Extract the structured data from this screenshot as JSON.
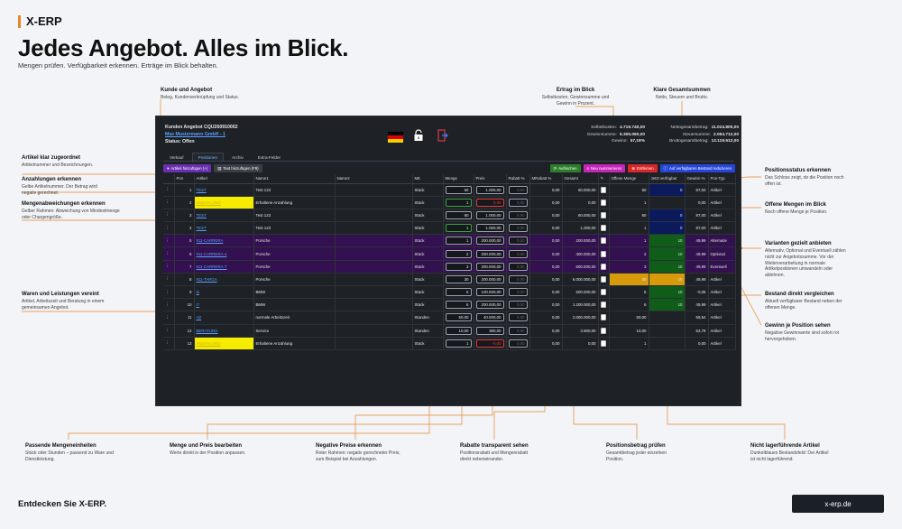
{
  "brand": "X-ERP",
  "hero": {
    "title": "Jedes Angebot. Alles im Blick.",
    "subtitle": "Mengen prüfen. Verfügbarkeit erkennen. Erträge im Blick behalten."
  },
  "annotations": {
    "kunde": {
      "title": "Kunde und Angebot",
      "text": "Beleg, Kundenverknüpfung und Status."
    },
    "ertrag": {
      "title": "Ertrag im Blick",
      "text": "Selbstkosten, Gewinnsumme und Gewinn in Prozent."
    },
    "gesamt": {
      "title": "Klare Gesamtsummen",
      "text": "Netto, Steuern und Brutto."
    },
    "artikel": {
      "title": "Artikel klar zugeordnet",
      "text": "Artikelnummer und Bezeichnungen."
    },
    "anzahlungen": {
      "title": "Anzahlungen erkennen",
      "text": "Gelbe Artikelnummer. Der Betrag wird negativ gerechnet."
    },
    "mengenabw": {
      "title": "Mengenabweichungen erkennen",
      "text": "Gelber Rahmen: Abweichung von Mindestmenge oder Chargengröße."
    },
    "waren": {
      "title": "Waren und Leistungen vereint",
      "text": "Artikel, Arbeitszeit und Beratung in einem gemeinsamen Angebot."
    },
    "positionsstatus": {
      "title": "Positionsstatus erkennen",
      "text": "Das Schloss zeigt, ob die Position noch offen ist."
    },
    "offene": {
      "title": "Offene Mengen im Blick",
      "text": "Noch offene Menge je Position."
    },
    "varianten": {
      "title": "Varianten gezielt anbieten",
      "text": "Alternativ, Optional und Eventuell zählen nicht zur Angebotssumme. Vor der Weiterverarbeitung in normale Artikelpositionen umwandeln oder ablehnen."
    },
    "bestand": {
      "title": "Bestand direkt vergleichen",
      "text": "Aktuell verfügbarer Bestand neben der offenen Menge."
    },
    "gewinn": {
      "title": "Gewinn je Position sehen",
      "text": "Negative Gewinnwerte sind sofort rot hervorgehoben."
    },
    "einheiten": {
      "title": "Passende Mengeneinheiten",
      "text": "Stück oder Stunden – passend zu Ware und Dienstleistung."
    },
    "mengepreis": {
      "title": "Menge und Preis bearbeiten",
      "text": "Werte direkt in der Position anpassen."
    },
    "negpreis": {
      "title": "Negative Preise erkennen",
      "text": "Roter Rahmen: negativ gerechneter Preis, zum Beispiel bei Anzahlungen."
    },
    "rabatte": {
      "title": "Rabatte transparent sehen",
      "text": "Positionsrabatt und Mengenrabatt direkt nebeneinander."
    },
    "posbetrag": {
      "title": "Positionsbetrag prüfen",
      "text": "Gesamtbetrag jeder einzelnen Position."
    },
    "nichtlager": {
      "title": "Nicht lagerführende Artikel",
      "text": "Dunkelblaues Bestandsfeld: Der Artikel ist nicht lagerführend."
    }
  },
  "app": {
    "doc_title": "Kunden Angebot CQU260910002",
    "customer": "Max Mustermann GmbH - 1",
    "status": "Status: Offen",
    "sums_left": [
      {
        "label": "Selbstkosten:",
        "value": "4.719.740,00"
      },
      {
        "label": "Gewinnsumme:",
        "value": "6.305.060,00"
      },
      {
        "label": "Gewinn:",
        "value": "57,19%"
      }
    ],
    "sums_right": [
      {
        "label": "Nettogesamtbetrag:",
        "value": "11.024.800,00"
      },
      {
        "label": "Steuersumme:",
        "value": "2.094.712,00"
      },
      {
        "label": "Bruttogesamtbetrag:",
        "value": "13.119.512,00"
      }
    ],
    "tabs": [
      "Verkauf",
      "Positionen",
      "Archiv",
      "Extra-Felder"
    ],
    "btn_add_article": "Artikel hinzufügen (+)",
    "btn_add_text": "Text hinzufügen (F9)",
    "btn_refresh": "Aufrischen",
    "btn_new": "Neu nummerieren",
    "btn_remove": "Entfernen",
    "btn_stock": "Auf verfügbaren Bestand reduzieren",
    "columns": [
      "",
      "Pos",
      "Artikel",
      "Name1",
      "Name2",
      "ME",
      "Menge",
      "Preis",
      "Rabatt %",
      "MRabatt %",
      "Gesamt",
      "",
      "Offene Menge",
      "Jetzt verfügbar",
      "Gewinn %",
      "Pos-Typ"
    ],
    "rows": [
      {
        "pos": "1",
        "artikel": "TEST",
        "name1": "Test 123",
        "me": "Stück",
        "menge": "60",
        "preis": "1.000,00",
        "rabatt": "0,00",
        "mrabatt": "0,00",
        "gesamt": "60.000,00",
        "offen": "60",
        "verf": "0",
        "gewinn": "87,00",
        "typ": "Artikel"
      },
      {
        "pos": "2",
        "artikel": "ANZAHLUNG",
        "name1": "Erhaltene Anzahlung",
        "me": "Stück",
        "menge": "1",
        "preis": "0,00",
        "rabatt": "0,00",
        "mrabatt": "0,00",
        "gesamt": "0,00",
        "offen": "1",
        "verf": "",
        "gewinn": "0,00",
        "typ": "Artikel"
      },
      {
        "pos": "3",
        "artikel": "TEST",
        "name1": "Test 123",
        "me": "Stück",
        "menge": "60",
        "preis": "1.000,00",
        "rabatt": "0,00",
        "mrabatt": "0,00",
        "gesamt": "60.000,00",
        "offen": "60",
        "verf": "0",
        "gewinn": "87,00",
        "typ": "Artikel"
      },
      {
        "pos": "4",
        "artikel": "TEST",
        "name1": "Test 123",
        "me": "Stück",
        "menge": "1",
        "preis": "1.000,00",
        "rabatt": "0,00",
        "mrabatt": "0,00",
        "gesamt": "1.000,00",
        "offen": "1",
        "verf": "0",
        "gewinn": "87,00",
        "typ": "Artikel"
      },
      {
        "pos": "5",
        "artikel": "911-CARRERA",
        "name1": "Porsche",
        "me": "Stück",
        "menge": "1",
        "preis": "200.000,00",
        "rabatt": "0,00",
        "mrabatt": "0,00",
        "gesamt": "200.000,00",
        "offen": "1",
        "verf": "10",
        "gewinn": "49,99",
        "typ": "Alternativ"
      },
      {
        "pos": "6",
        "artikel": "911-CARRERA-4",
        "name1": "Porsche",
        "me": "Stück",
        "menge": "2",
        "preis": "200.000,00",
        "rabatt": "0,00",
        "mrabatt": "0,00",
        "gesamt": "400.000,00",
        "offen": "2",
        "verf": "10",
        "gewinn": "49,99",
        "typ": "Optional"
      },
      {
        "pos": "7",
        "artikel": "911-CARRERA-T",
        "name1": "Porsche",
        "me": "Stück",
        "menge": "3",
        "preis": "200.000,00",
        "rabatt": "0,00",
        "mrabatt": "0,00",
        "gesamt": "600.000,00",
        "offen": "3",
        "verf": "10",
        "gewinn": "49,99",
        "typ": "Eventuell"
      },
      {
        "pos": "8",
        "artikel": "911-TARGA",
        "name1": "Porsche",
        "me": "Stück",
        "menge": "30",
        "preis": "200.000,00",
        "rabatt": "0,00",
        "mrabatt": "0,00",
        "gesamt": "6.000.000,00",
        "offen": "30",
        "verf": "10",
        "gewinn": "49,99",
        "typ": "Artikel"
      },
      {
        "pos": "9",
        "artikel": "i5",
        "name1": "BMW",
        "me": "Stück",
        "menge": "5",
        "preis": "100.000,00",
        "rabatt": "0,00",
        "mrabatt": "0,00",
        "gesamt": "500.000,00",
        "offen": "5",
        "verf": "10",
        "gewinn": "-0,05",
        "typ": "Artikel"
      },
      {
        "pos": "10",
        "artikel": "i7",
        "name1": "BMW",
        "me": "Stück",
        "menge": "6",
        "preis": "200.000,00",
        "rabatt": "0,00",
        "mrabatt": "0,00",
        "gesamt": "1.200.000,00",
        "offen": "6",
        "verf": "10",
        "gewinn": "49,99",
        "typ": "Artikel"
      },
      {
        "pos": "11",
        "artikel": "AZ",
        "name1": "normale Arbeitszeit",
        "me": "Stunden",
        "menge": "50,00",
        "preis": "40.000,00",
        "rabatt": "0,00",
        "mrabatt": "0,00",
        "gesamt": "2.000.000,00",
        "offen": "50,00",
        "verf": "",
        "gewinn": "59,54",
        "typ": "Artikel"
      },
      {
        "pos": "12",
        "artikel": "BERATUNG",
        "name1": "Service",
        "me": "Stunden",
        "menge": "10,00",
        "preis": "380,00",
        "rabatt": "0,00",
        "mrabatt": "0,00",
        "gesamt": "3.800,00",
        "offen": "10,00",
        "verf": "",
        "gewinn": "52,79",
        "typ": "Artikel"
      },
      {
        "pos": "13",
        "artikel": "ANZAHLUNG",
        "name1": "Erhaltene Anzahlung",
        "me": "Stück",
        "menge": "1",
        "preis": "-0,00",
        "rabatt": "0,00",
        "mrabatt": "0,00",
        "gesamt": "0,00",
        "offen": "1",
        "verf": "",
        "gewinn": "0,00",
        "typ": "Artikel"
      }
    ]
  },
  "cta": {
    "text": "Entdecken Sie X-ERP.",
    "button": "x-erp.de"
  }
}
